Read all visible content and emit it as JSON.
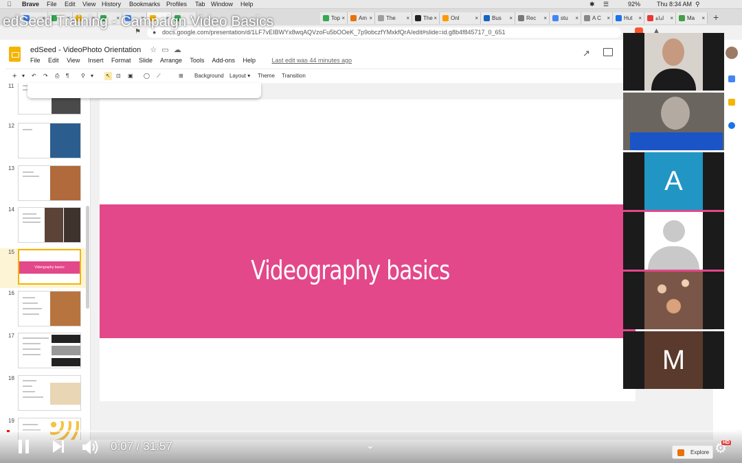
{
  "menubar": {
    "app": "Brave",
    "items": [
      "File",
      "Edit",
      "View",
      "History",
      "Bookmarks",
      "Profiles",
      "Tab",
      "Window",
      "Help"
    ],
    "battery": "92%",
    "clock": "Thu 8:34 AM"
  },
  "tabs": [
    "",
    "",
    "",
    "",
    "",
    "",
    "",
    "Top",
    "Am",
    "The",
    "The",
    "Onl",
    "Bus",
    "Rec",
    "stu",
    "A C",
    "Hut",
    "اداة",
    "Ma"
  ],
  "address": {
    "url": "docs.google.com/presentation/d/1LF7vEIBWYx8wqAQVzoFu5bOOeK_7p9obczfYMxkfQrA/edit#slide=id.g8b4f845717_0_651"
  },
  "video": {
    "title": "edSeed Training - Campaign Video Basics",
    "time": "0:07 / 31:57",
    "progress_fraction": 0.0037
  },
  "doc": {
    "title": "edSeed - VideoPhoto Orientation",
    "menu": [
      "File",
      "Edit",
      "View",
      "Insert",
      "Format",
      "Slide",
      "Arrange",
      "Tools",
      "Add-ons",
      "Help"
    ],
    "last_edit": "Last edit was 44 minutes ago"
  },
  "toolbar": {
    "add": "+",
    "background": "Background",
    "layout": "Layout",
    "theme": "Theme",
    "transition": "Transition"
  },
  "filmstrip": {
    "numbers": [
      "11",
      "12",
      "13",
      "14",
      "15",
      "16",
      "17",
      "18",
      "19"
    ],
    "selected": "15",
    "selected_thumb_text": "Videography basics"
  },
  "slide": {
    "title": "Videography basics",
    "band_color": "#e3488a"
  },
  "participants": {
    "tile_letters": [
      "A",
      "M"
    ],
    "tile_colors": [
      "#2196c4",
      "#5a3a2c"
    ]
  },
  "explore": {
    "label": "Explore"
  },
  "hd_badge": "HD"
}
